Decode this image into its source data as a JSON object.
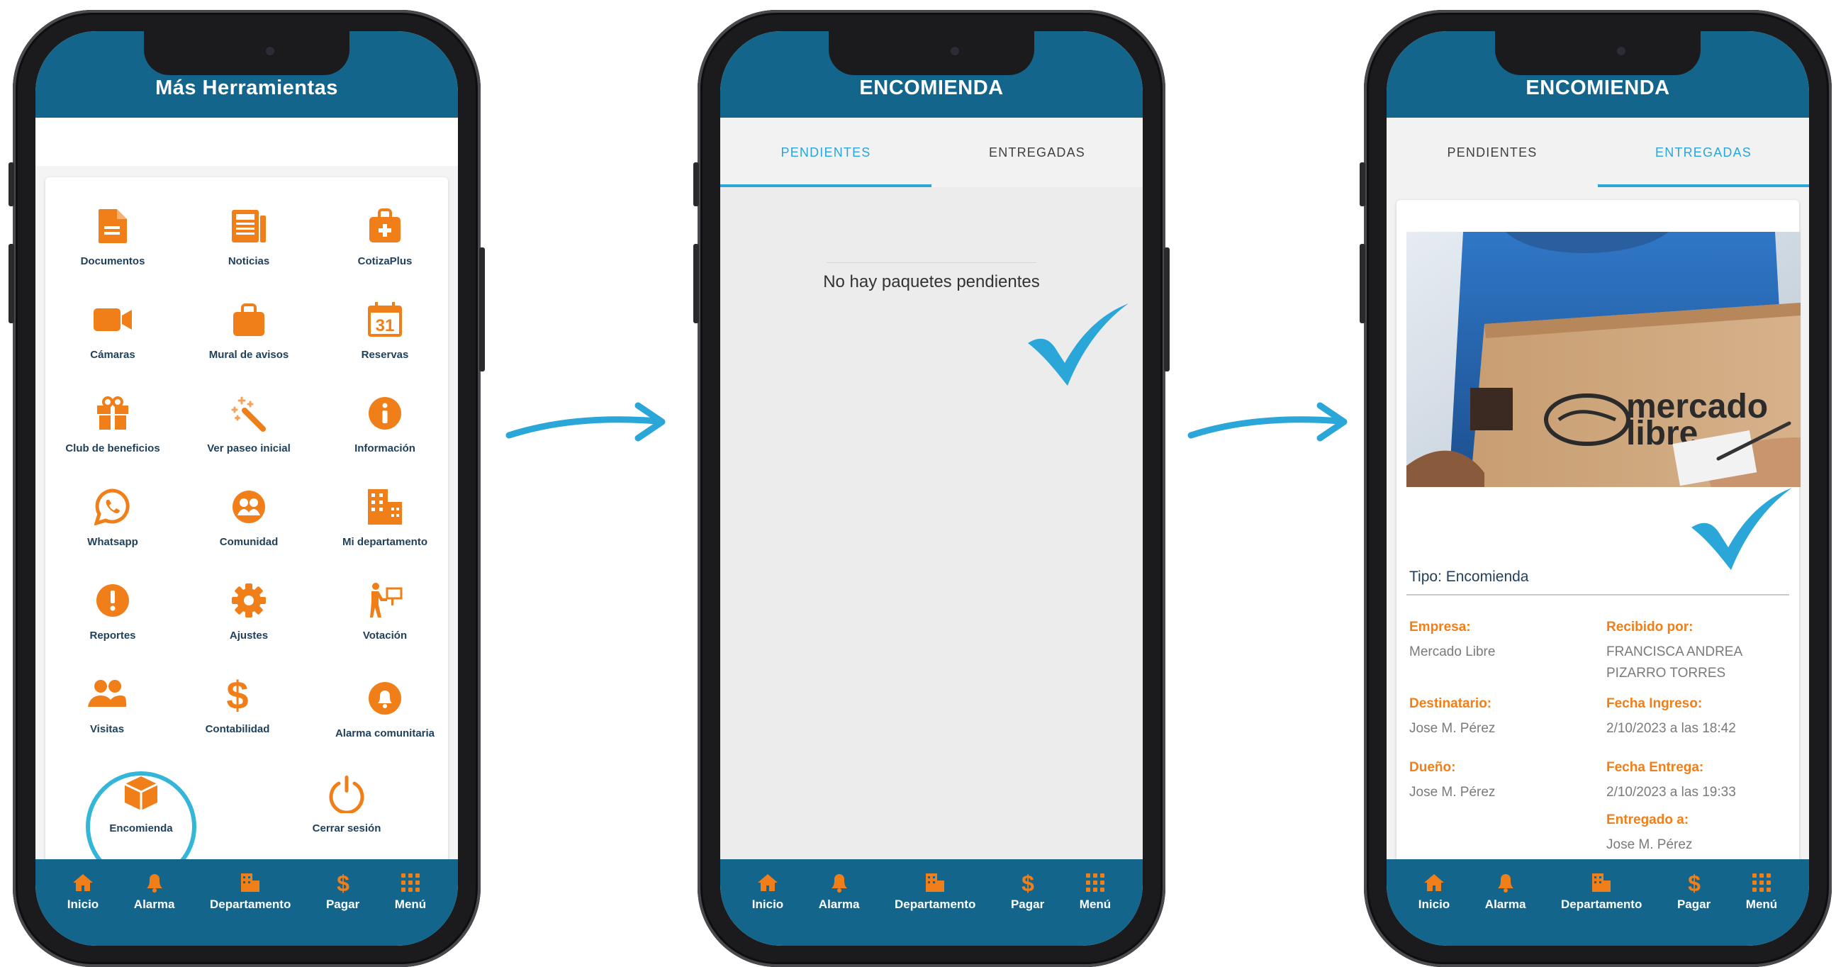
{
  "colors": {
    "primary": "#13658c",
    "accent_orange": "#f07f1a",
    "accent_cyan": "#2aa6d9"
  },
  "nav": [
    {
      "label": "Inicio",
      "icon": "home-icon"
    },
    {
      "label": "Alarma",
      "icon": "bell-icon"
    },
    {
      "label": "Departamento",
      "icon": "building-icon"
    },
    {
      "label": "Pagar",
      "icon": "dollar-icon"
    },
    {
      "label": "Menú",
      "icon": "grid-icon"
    }
  ],
  "screen1": {
    "title": "Más Herramientas",
    "tools": [
      {
        "label": "Documentos",
        "icon": "document-icon"
      },
      {
        "label": "Noticias",
        "icon": "newspaper-icon"
      },
      {
        "label": "CotizaPlus",
        "icon": "medical-bag-icon"
      },
      {
        "label": "Cámaras",
        "icon": "video-camera-icon"
      },
      {
        "label": "Mural de avisos",
        "icon": "bag-icon"
      },
      {
        "label": "Reservas",
        "icon": "calendar-icon",
        "badge": "31"
      },
      {
        "label": "Club de beneficios",
        "icon": "gift-icon"
      },
      {
        "label": "Ver paseo inicial",
        "icon": "magic-wand-icon"
      },
      {
        "label": "Información",
        "icon": "info-icon"
      },
      {
        "label": "Whatsapp",
        "icon": "whatsapp-icon"
      },
      {
        "label": "Comunidad",
        "icon": "community-icon"
      },
      {
        "label": "Mi departamento",
        "icon": "apartment-icon"
      },
      {
        "label": "Reportes",
        "icon": "alert-icon"
      },
      {
        "label": "Ajustes",
        "icon": "gear-icon"
      },
      {
        "label": "Votación",
        "icon": "vote-icon"
      },
      {
        "label": "Visitas",
        "icon": "users-icon"
      },
      {
        "label": "Contabilidad",
        "icon": "dollar-icon"
      },
      {
        "label": "Alarma comunitaria",
        "icon": "bell-icon"
      },
      {
        "label": "Encomienda",
        "icon": "package-icon"
      },
      {
        "label": "Cerrar sesión",
        "icon": "power-icon"
      }
    ]
  },
  "screen2": {
    "title": "ENCOMIENDA",
    "tabs": [
      "PENDIENTES",
      "ENTREGADAS"
    ],
    "empty_message": "No hay paquetes pendientes"
  },
  "screen3": {
    "title": "ENCOMIENDA",
    "tabs": [
      "PENDIENTES",
      "ENTREGADAS"
    ],
    "photo_logo": {
      "line1": "mercado",
      "line2": "libre"
    },
    "tipo": "Tipo: Encomienda",
    "left_fields": [
      {
        "label": "Empresa:",
        "value": "Mercado Libre"
      },
      {
        "label": "Destinatario:",
        "value": "Jose M. Pérez"
      },
      {
        "label": "Dueño:",
        "value": "Jose M. Pérez"
      }
    ],
    "right_fields": [
      {
        "label": "Recibido por:",
        "value": "FRANCISCA ANDREA PIZARRO TORRES"
      },
      {
        "label": "Fecha Ingreso:",
        "value": "2/10/2023 a las 18:42"
      },
      {
        "label": "Fecha Entrega:",
        "value": "2/10/2023 a las 19:33"
      },
      {
        "label": "Entregado a:",
        "value": "Jose M. Pérez"
      }
    ]
  }
}
